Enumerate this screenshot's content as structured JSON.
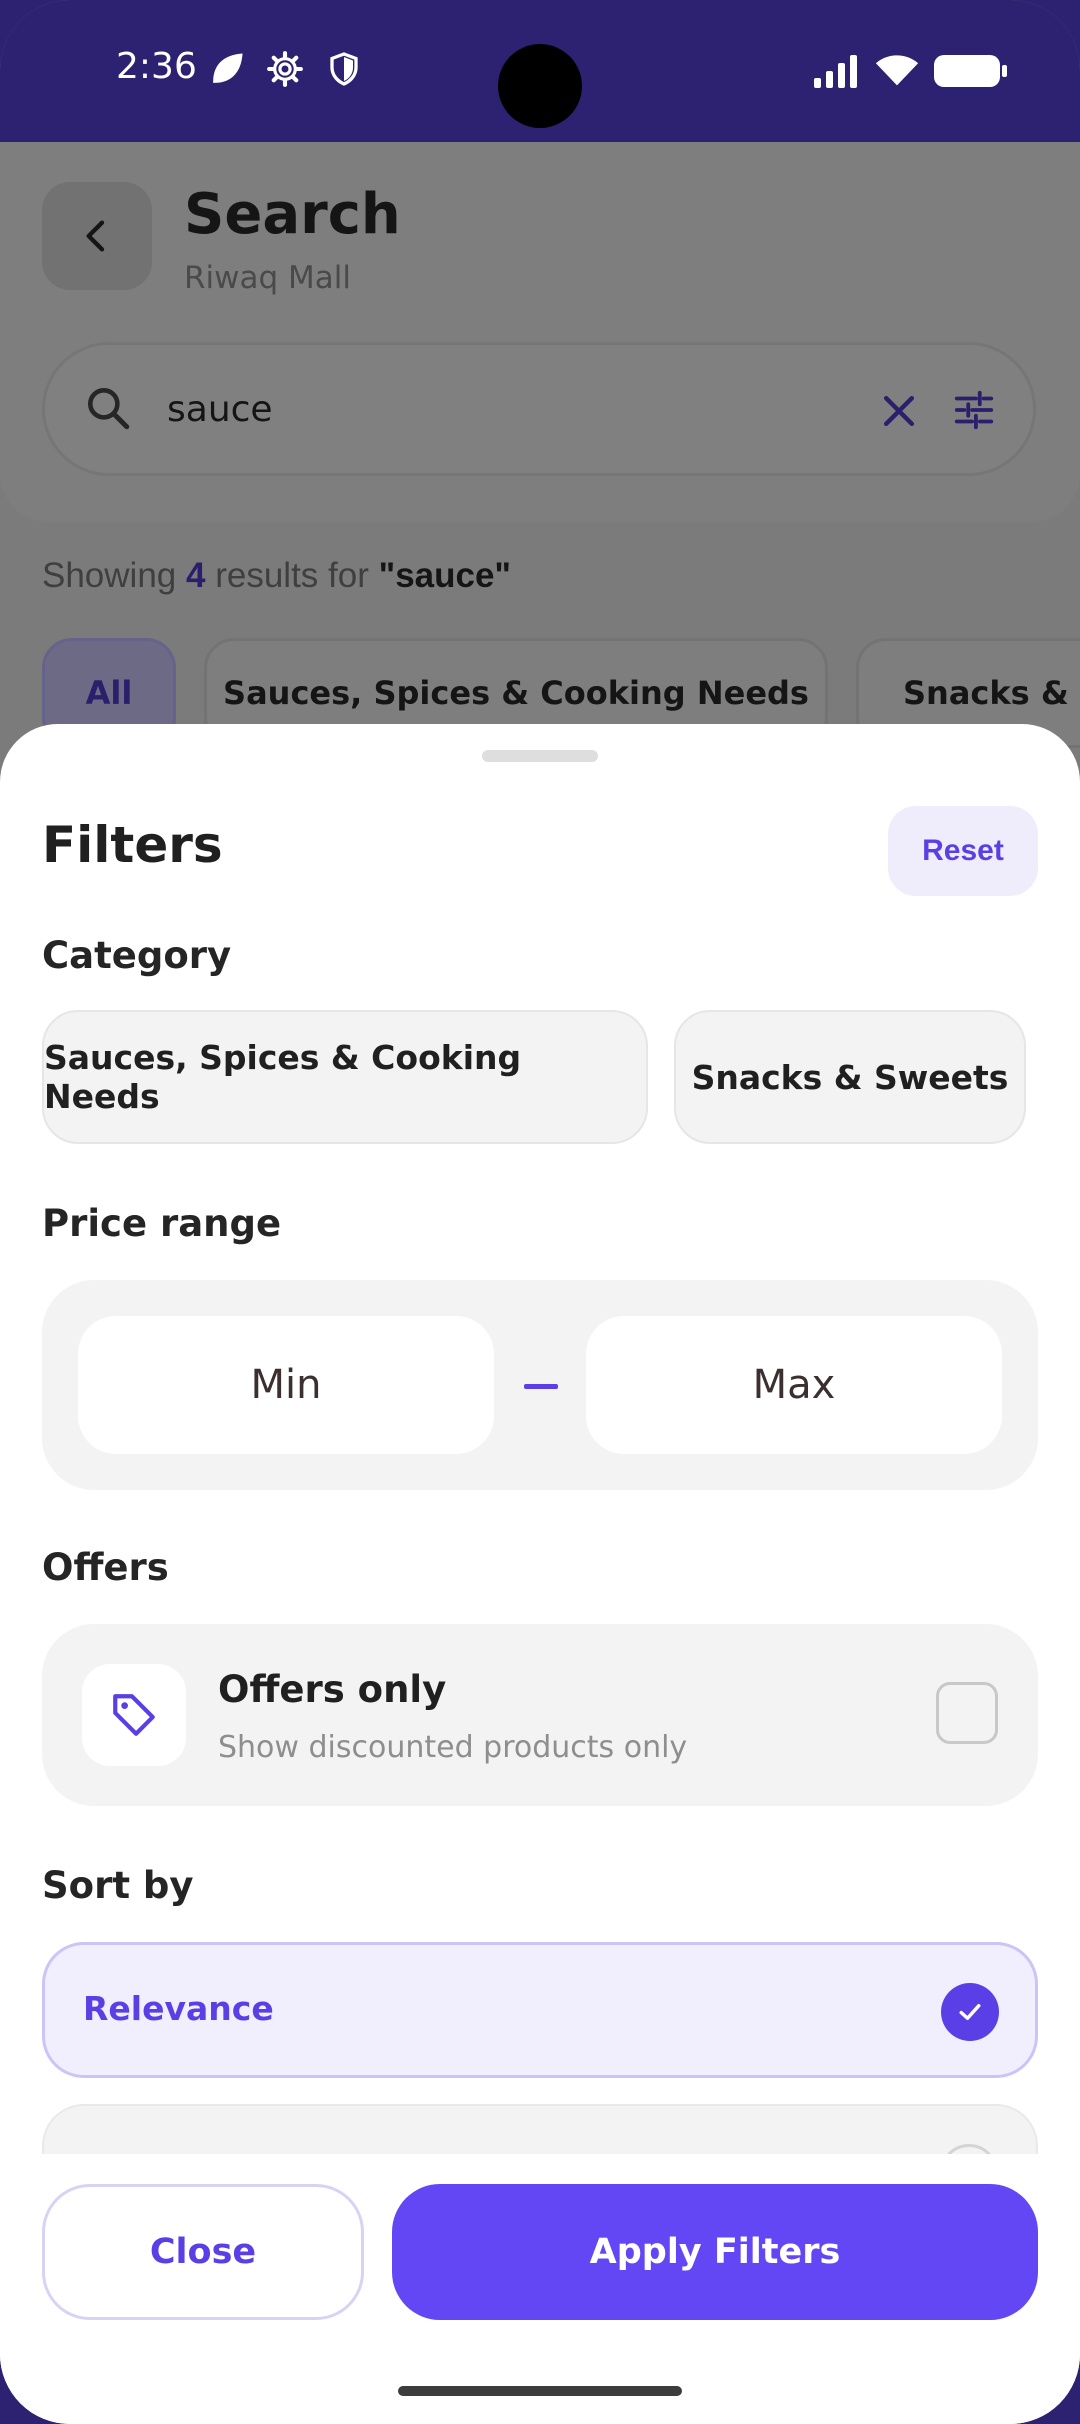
{
  "status_bar": {
    "time": "2:36",
    "icons": [
      "leaf-icon",
      "gear-icon",
      "shield-icon",
      "signal-icon",
      "wifi-icon",
      "battery-icon"
    ]
  },
  "header": {
    "title": "Search",
    "subtitle": "Riwaq Mall"
  },
  "search": {
    "query": "sauce"
  },
  "results": {
    "prefix": "Showing",
    "count": "4",
    "middle": "results for",
    "quoted_query": "\"sauce\""
  },
  "category_tabs": [
    "All",
    "Sauces, Spices & Cooking Needs",
    "Snacks & S"
  ],
  "filters": {
    "title": "Filters",
    "reset_label": "Reset",
    "category_label": "Category",
    "categories": [
      "Sauces, Spices & Cooking Needs",
      "Snacks & Sweets"
    ],
    "price_label": "Price range",
    "min_placeholder": "Min",
    "max_placeholder": "Max",
    "offers_label": "Offers",
    "offers_title": "Offers only",
    "offers_subtitle": "Show discounted products only",
    "offers_checked": false,
    "sort_label": "Sort by",
    "sort_selected": "Relevance"
  },
  "footer": {
    "close_label": "Close",
    "apply_label": "Apply Filters"
  },
  "colors": {
    "accent": "#5b3fe6",
    "apply_button": "#6347f5",
    "status_bar": "#2d2272"
  }
}
